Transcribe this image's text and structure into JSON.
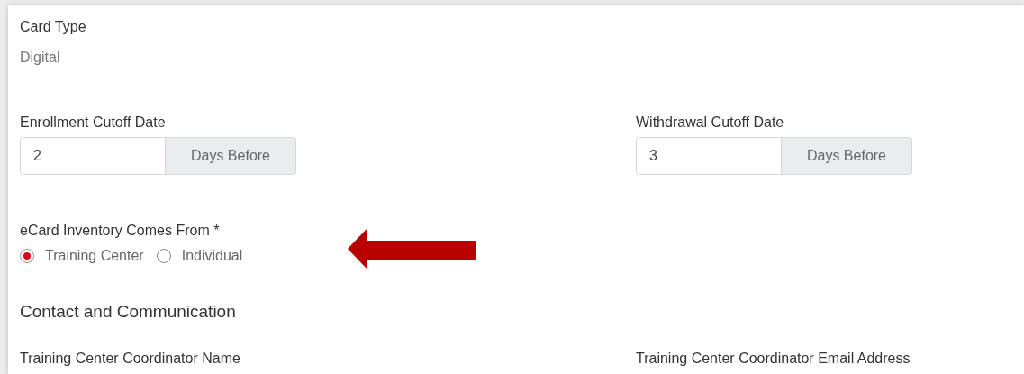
{
  "card_type": {
    "label": "Card Type",
    "value": "Digital"
  },
  "cutoffs": [
    {
      "label": "Enrollment Cutoff Date",
      "value": "2",
      "addon": "Days Before"
    },
    {
      "label": "Withdrawal Cutoff Date",
      "value": "3",
      "addon": "Days Before"
    }
  ],
  "inventory": {
    "label": "eCard Inventory Comes From *",
    "options": [
      {
        "label": "Training Center",
        "selected": true
      },
      {
        "label": "Individual",
        "selected": false
      }
    ]
  },
  "section_title": "Contact and Communication",
  "contact_fields": [
    {
      "label": "Training Center Coordinator Name"
    },
    {
      "label": "Training Center Coordinator Email Address"
    }
  ]
}
